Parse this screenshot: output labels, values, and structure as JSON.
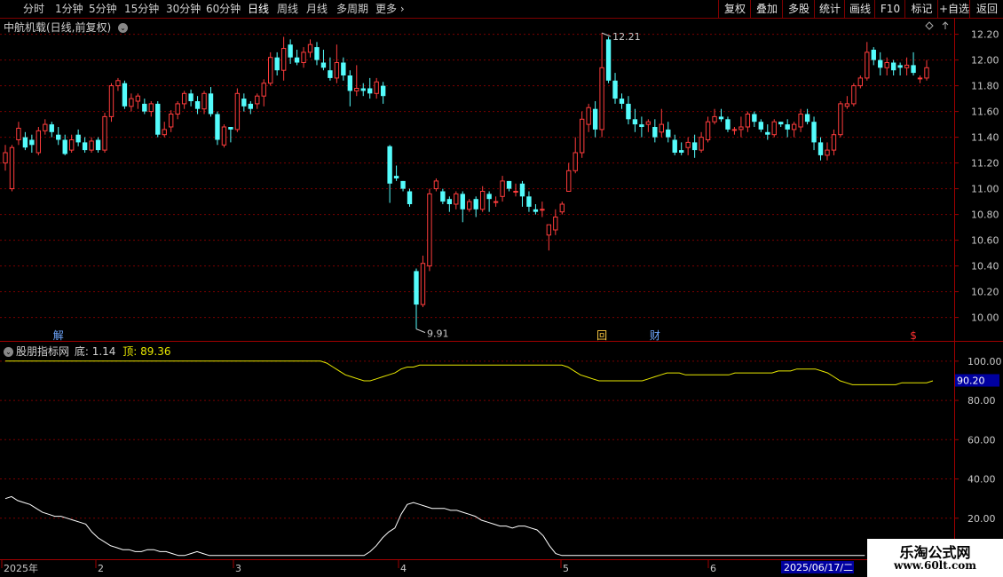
{
  "toolbar": {
    "left": [
      "分时",
      "1分钟",
      "5分钟",
      "15分钟",
      "30分钟",
      "60分钟",
      "日线",
      "周线",
      "月线",
      "多周期",
      "更多"
    ],
    "active": "日线",
    "right": [
      "复权",
      "叠加",
      "多股",
      "统计",
      "画线",
      "F10",
      "标记",
      "+自选",
      "返回"
    ]
  },
  "main_title": "中航机载(日线,前复权)",
  "indicator": {
    "name": "股朋指标网",
    "bottom_label": "底: 1.14",
    "top_label": "顶: 89.36"
  },
  "event_markers": [
    {
      "label": "解",
      "color": "#6fa8ff",
      "idx": 8
    },
    {
      "label": "回",
      "color": "#ffcc44",
      "idx": 90
    },
    {
      "label": "财",
      "color": "#6fa8ff",
      "idx": 98
    },
    {
      "label": "$",
      "color": "#ff3030",
      "idx": 137
    }
  ],
  "date_axis": {
    "labels": [
      "2025年",
      "2",
      "3",
      "4",
      "5",
      "6"
    ],
    "cursor": "2025/06/17/二"
  },
  "watermark": {
    "title": "乐淘公式网",
    "url": "www.60lt.com"
  },
  "chart_data": [
    {
      "type": "candlestick",
      "price_axis": {
        "ticks": [
          "12.20",
          "12.00",
          "11.80",
          "11.60",
          "11.40",
          "11.20",
          "11.00",
          "10.80",
          "10.60",
          "10.40",
          "10.20",
          "10.00"
        ],
        "ylim": [
          9.88,
          12.28
        ]
      },
      "annotations": {
        "high": "12.21",
        "low": "9.91"
      },
      "candles": [
        [
          11.2,
          11.28,
          11.14,
          11.34
        ],
        [
          11.0,
          11.32,
          10.98,
          11.34
        ],
        [
          11.38,
          11.47,
          11.34,
          11.52
        ],
        [
          11.4,
          11.32,
          11.3,
          11.44
        ],
        [
          11.38,
          11.34,
          11.28,
          11.42
        ],
        [
          11.28,
          11.45,
          11.26,
          11.48
        ],
        [
          11.45,
          11.5,
          11.42,
          11.54
        ],
        [
          11.5,
          11.44,
          11.4,
          11.52
        ],
        [
          11.42,
          11.38,
          11.34,
          11.48
        ],
        [
          11.38,
          11.27,
          11.26,
          11.42
        ],
        [
          11.3,
          11.38,
          11.28,
          11.42
        ],
        [
          11.42,
          11.36,
          11.33,
          11.46
        ],
        [
          11.36,
          11.3,
          11.28,
          11.4
        ],
        [
          11.3,
          11.37,
          11.28,
          11.4
        ],
        [
          11.38,
          11.3,
          11.28,
          11.4
        ],
        [
          11.3,
          11.56,
          11.28,
          11.59
        ],
        [
          11.56,
          11.8,
          11.52,
          11.82
        ],
        [
          11.8,
          11.84,
          11.76,
          11.86
        ],
        [
          11.82,
          11.64,
          11.62,
          11.84
        ],
        [
          11.64,
          11.7,
          11.6,
          11.74
        ],
        [
          11.68,
          11.72,
          11.62,
          11.74
        ],
        [
          11.66,
          11.6,
          11.58,
          11.7
        ],
        [
          11.6,
          11.66,
          11.56,
          11.68
        ],
        [
          11.66,
          11.42,
          11.4,
          11.68
        ],
        [
          11.42,
          11.46,
          11.4,
          11.52
        ],
        [
          11.48,
          11.58,
          11.44,
          11.61
        ],
        [
          11.58,
          11.66,
          11.54,
          11.68
        ],
        [
          11.66,
          11.74,
          11.62,
          11.76
        ],
        [
          11.74,
          11.68,
          11.64,
          11.77
        ],
        [
          11.68,
          11.62,
          11.58,
          11.72
        ],
        [
          11.62,
          11.74,
          11.58,
          11.76
        ],
        [
          11.74,
          11.58,
          11.56,
          11.79
        ],
        [
          11.58,
          11.38,
          11.34,
          11.6
        ],
        [
          11.34,
          11.48,
          11.32,
          11.5
        ],
        [
          11.48,
          11.46,
          11.36,
          11.48
        ],
        [
          11.46,
          11.74,
          11.44,
          11.78
        ],
        [
          11.7,
          11.64,
          11.6,
          11.74
        ],
        [
          11.66,
          11.62,
          11.58,
          11.68
        ],
        [
          11.66,
          11.72,
          11.62,
          11.74
        ],
        [
          11.72,
          11.82,
          11.64,
          11.85
        ],
        [
          11.82,
          12.02,
          11.8,
          12.06
        ],
        [
          12.02,
          11.92,
          11.88,
          12.06
        ],
        [
          11.92,
          12.09,
          11.84,
          12.18
        ],
        [
          12.12,
          12.02,
          11.97,
          12.16
        ],
        [
          12.02,
          11.98,
          11.96,
          12.08
        ],
        [
          11.98,
          12.06,
          11.94,
          12.1
        ],
        [
          12.06,
          12.12,
          12.02,
          12.16
        ],
        [
          12.1,
          12.0,
          11.96,
          12.14
        ],
        [
          11.98,
          11.94,
          11.92,
          12.08
        ],
        [
          11.92,
          11.86,
          11.84,
          12.02
        ],
        [
          11.86,
          11.98,
          11.82,
          12.12
        ],
        [
          11.98,
          11.88,
          11.84,
          12.02
        ],
        [
          11.88,
          11.76,
          11.64,
          11.92
        ],
        [
          11.76,
          11.78,
          11.72,
          11.96
        ],
        [
          11.78,
          11.76,
          11.72,
          11.82
        ],
        [
          11.78,
          11.74,
          11.7,
          11.86
        ],
        [
          11.74,
          11.83,
          11.7,
          11.86
        ],
        [
          11.8,
          11.72,
          11.66,
          11.83
        ],
        [
          11.33,
          11.04,
          10.89,
          11.34
        ],
        [
          11.1,
          11.08,
          11.06,
          11.18
        ],
        [
          11.06,
          11.0,
          10.98,
          11.06
        ],
        [
          10.98,
          10.88,
          10.86,
          11.0
        ],
        [
          10.36,
          10.1,
          9.91,
          10.38
        ],
        [
          10.1,
          10.42,
          10.08,
          10.48
        ],
        [
          10.4,
          10.96,
          10.36,
          11.0
        ],
        [
          11.0,
          11.06,
          10.98,
          11.08
        ],
        [
          10.98,
          10.9,
          10.88,
          11.0
        ],
        [
          10.92,
          10.88,
          10.82,
          10.94
        ],
        [
          10.88,
          10.96,
          10.84,
          10.98
        ],
        [
          10.96,
          10.84,
          10.74,
          10.98
        ],
        [
          10.84,
          10.9,
          10.82,
          10.92
        ],
        [
          10.92,
          10.84,
          10.78,
          10.94
        ],
        [
          10.84,
          10.98,
          10.82,
          11.02
        ],
        [
          10.96,
          10.92,
          10.82,
          10.98
        ],
        [
          10.9,
          10.9,
          10.86,
          10.94
        ],
        [
          10.94,
          11.06,
          10.9,
          11.1
        ],
        [
          11.06,
          11.0,
          10.98,
          11.06
        ],
        [
          10.98,
          10.98,
          10.94,
          11.04
        ],
        [
          11.04,
          10.94,
          10.86,
          11.06
        ],
        [
          10.94,
          10.86,
          10.82,
          10.98
        ],
        [
          10.84,
          10.82,
          10.8,
          10.88
        ],
        [
          10.84,
          10.84,
          10.78,
          10.9
        ],
        [
          10.64,
          10.72,
          10.52,
          10.72
        ],
        [
          10.68,
          10.78,
          10.64,
          10.84
        ],
        [
          10.82,
          10.88,
          10.8,
          10.9
        ],
        [
          10.98,
          11.14,
          10.98,
          11.2
        ],
        [
          11.14,
          11.28,
          11.12,
          11.4
        ],
        [
          11.28,
          11.54,
          11.24,
          11.6
        ],
        [
          11.5,
          11.63,
          11.44,
          11.66
        ],
        [
          11.62,
          11.46,
          11.4,
          11.68
        ],
        [
          11.46,
          11.94,
          11.4,
          12.21
        ],
        [
          12.16,
          11.84,
          11.82,
          12.18
        ],
        [
          11.84,
          11.7,
          11.66,
          11.9
        ],
        [
          11.7,
          11.66,
          11.62,
          11.74
        ],
        [
          11.66,
          11.54,
          11.5,
          11.72
        ],
        [
          11.54,
          11.5,
          11.44,
          11.62
        ],
        [
          11.5,
          11.48,
          11.4,
          11.56
        ],
        [
          11.5,
          11.52,
          11.44,
          11.54
        ],
        [
          11.48,
          11.4,
          11.36,
          11.54
        ],
        [
          11.44,
          11.5,
          11.4,
          11.62
        ],
        [
          11.46,
          11.4,
          11.36,
          11.52
        ],
        [
          11.38,
          11.28,
          11.26,
          11.42
        ],
        [
          11.3,
          11.28,
          11.26,
          11.36
        ],
        [
          11.32,
          11.36,
          11.26,
          11.4
        ],
        [
          11.36,
          11.3,
          11.24,
          11.42
        ],
        [
          11.3,
          11.4,
          11.28,
          11.44
        ],
        [
          11.38,
          11.52,
          11.36,
          11.56
        ],
        [
          11.52,
          11.56,
          11.5,
          11.62
        ],
        [
          11.56,
          11.54,
          11.52,
          11.62
        ],
        [
          11.54,
          11.46,
          11.44,
          11.56
        ],
        [
          11.46,
          11.46,
          11.42,
          11.48
        ],
        [
          11.46,
          11.48,
          11.4,
          11.56
        ],
        [
          11.48,
          11.58,
          11.44,
          11.6
        ],
        [
          11.58,
          11.52,
          11.48,
          11.6
        ],
        [
          11.52,
          11.46,
          11.44,
          11.54
        ],
        [
          11.44,
          11.42,
          11.38,
          11.5
        ],
        [
          11.42,
          11.52,
          11.4,
          11.54
        ],
        [
          11.52,
          11.5,
          11.48,
          11.52
        ],
        [
          11.5,
          11.46,
          11.4,
          11.54
        ],
        [
          11.46,
          11.5,
          11.4,
          11.52
        ],
        [
          11.48,
          11.58,
          11.44,
          11.62
        ],
        [
          11.58,
          11.52,
          11.5,
          11.62
        ],
        [
          11.52,
          11.36,
          11.3,
          11.56
        ],
        [
          11.36,
          11.26,
          11.22,
          11.4
        ],
        [
          11.26,
          11.3,
          11.22,
          11.36
        ],
        [
          11.3,
          11.42,
          11.26,
          11.46
        ],
        [
          11.42,
          11.66,
          11.4,
          11.68
        ],
        [
          11.64,
          11.66,
          11.62,
          11.72
        ],
        [
          11.66,
          11.8,
          11.64,
          11.82
        ],
        [
          11.8,
          11.86,
          11.78,
          11.88
        ],
        [
          11.86,
          12.06,
          11.84,
          12.14
        ],
        [
          12.08,
          12.0,
          11.96,
          12.1
        ],
        [
          12.0,
          11.94,
          11.88,
          12.06
        ],
        [
          11.94,
          11.98,
          11.88,
          12.02
        ],
        [
          11.98,
          11.92,
          11.88,
          12.0
        ],
        [
          11.96,
          11.94,
          11.88,
          11.98
        ],
        [
          11.94,
          11.96,
          11.88,
          12.02
        ],
        [
          11.96,
          11.9,
          11.88,
          12.06
        ],
        [
          11.86,
          11.86,
          11.82,
          11.88
        ],
        [
          11.86,
          11.94,
          11.84,
          12.0
        ]
      ]
    },
    {
      "type": "line",
      "value_axis": {
        "ticks": [
          "100.00",
          "80.00",
          "60.00",
          "40.00",
          "20.00"
        ],
        "ylim": [
          0,
          104
        ]
      },
      "current_value": "90.20",
      "series": [
        {
          "color": "#e8e800",
          "values": [
            100,
            100,
            100,
            100,
            100,
            100,
            100,
            100,
            100,
            100,
            100,
            100,
            100,
            100,
            100,
            100,
            100,
            100,
            100,
            100,
            100,
            100,
            100,
            100,
            100,
            100,
            100,
            100,
            100,
            100,
            100,
            100,
            100,
            100,
            100,
            100,
            100,
            100,
            100,
            100,
            100,
            100,
            100,
            100,
            100,
            100,
            100,
            100,
            100,
            100,
            100,
            100,
            100,
            100,
            100,
            100,
            100,
            100,
            100,
            100,
            100,
            100,
            100,
            100,
            100,
            100,
            100,
            100,
            100,
            100,
            100,
            100,
            100,
            100,
            100,
            100,
            100,
            100,
            100,
            100,
            100,
            100,
            100,
            100,
            100,
            100,
            100,
            100,
            100,
            100,
            100,
            100,
            100,
            100,
            100,
            100,
            100,
            100,
            100,
            100,
            100,
            100,
            100,
            100,
            100,
            100,
            100,
            100,
            100,
            100,
            100,
            100,
            100,
            100,
            100,
            100,
            100,
            100,
            100,
            100,
            100,
            100,
            100,
            100,
            100,
            100,
            100,
            100,
            100,
            100,
            100,
            100,
            100,
            100,
            100,
            100,
            100,
            100,
            100,
            100,
            100,
            100,
            100,
            100,
            100,
            100,
            100,
            100,
            100,
            100
          ]
        },
        {
          "color": "#ffffff",
          "values": [
            30,
            31,
            29,
            28,
            27,
            25,
            23,
            22,
            21,
            21,
            20,
            19,
            18,
            17,
            13,
            10,
            8,
            6,
            5,
            4,
            4,
            3,
            3,
            4,
            4,
            3,
            3,
            2,
            1,
            1,
            2,
            3,
            2,
            1,
            1,
            1,
            1,
            1,
            1,
            1,
            1,
            1,
            1,
            1,
            1,
            1,
            1,
            1,
            1,
            1,
            1,
            1,
            1,
            1,
            1,
            1,
            1,
            1,
            1,
            3,
            6,
            10,
            13,
            15,
            22,
            27,
            28,
            27,
            26,
            25,
            25,
            25,
            24,
            24,
            23,
            22,
            21,
            19,
            18,
            17,
            16,
            16,
            15,
            16,
            16,
            15,
            14,
            11,
            6,
            2,
            1,
            1,
            1,
            1,
            1,
            1,
            1,
            1,
            1,
            1,
            1,
            1,
            1,
            1,
            1,
            1,
            1,
            1,
            1,
            1,
            1,
            1,
            1,
            1,
            1,
            1,
            1,
            1,
            1,
            1,
            1,
            1,
            1,
            1,
            1,
            1,
            1,
            1,
            1,
            1,
            1,
            1,
            1,
            1,
            1,
            1,
            1,
            1,
            1,
            1,
            1,
            1,
            1,
            1,
            1,
            1,
            1,
            1,
            1,
            1
          ]
        }
      ]
    }
  ]
}
